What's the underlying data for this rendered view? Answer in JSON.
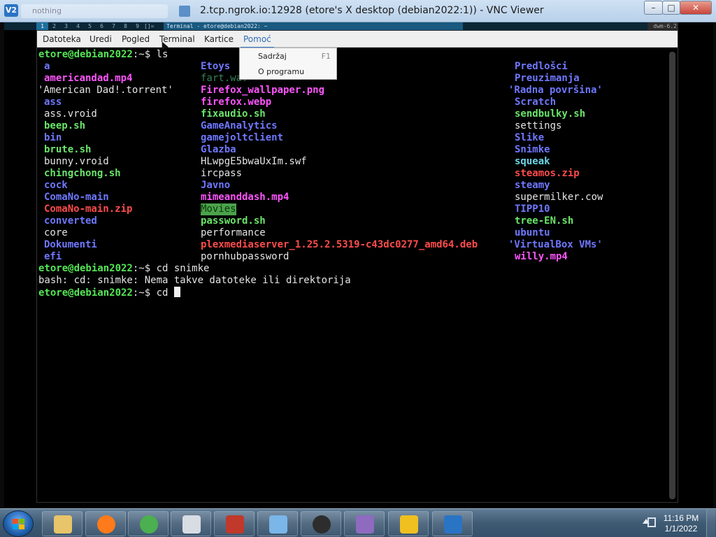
{
  "vnc_window": {
    "icon_label": "V2",
    "ghost_tab_label": "nothing",
    "title": "2.tcp.ngrok.io:12928 (etore's X desktop (debian2022:1)) - VNC Viewer",
    "buttons": {
      "minimize": "–",
      "maximize": "□",
      "close": "✕"
    }
  },
  "dwm": {
    "tags": [
      "1",
      "2",
      "3",
      "4",
      "5",
      "6",
      "7",
      "8",
      "9"
    ],
    "selected_tag": "1",
    "layout_symbol": "[]=",
    "window_title": "Terminal - etore@debian2022: ~",
    "status": "dwm-6.2"
  },
  "menubar": {
    "items": [
      "Datoteka",
      "Uredi",
      "Pogled",
      "Terminal",
      "Kartice",
      "Pomoć"
    ],
    "active": "Pomoć"
  },
  "help_menu": {
    "items": [
      {
        "label": "Sadržaj",
        "shortcut": "F1"
      },
      {
        "label": "O programu",
        "shortcut": ""
      }
    ]
  },
  "terminal": {
    "prompt": "etore@debian2022",
    "cwd": ":~$",
    "cmd1": "ls",
    "ls_col1": [
      {
        "name": "a",
        "type": "dir"
      },
      {
        "name": "americandad.mp4",
        "type": "media"
      },
      {
        "name": "'American Dad!.torrent'",
        "type": "plain"
      },
      {
        "name": "ass",
        "type": "dir"
      },
      {
        "name": "ass.vroid",
        "type": "plain"
      },
      {
        "name": "beep.sh",
        "type": "exec"
      },
      {
        "name": "bin",
        "type": "dir"
      },
      {
        "name": "brute.sh",
        "type": "exec"
      },
      {
        "name": "bunny.vroid",
        "type": "plain"
      },
      {
        "name": "chingchong.sh",
        "type": "exec"
      },
      {
        "name": "cock",
        "type": "dir"
      },
      {
        "name": "ComaNo-main",
        "type": "dir"
      },
      {
        "name": "ComaNo-main.zip",
        "type": "arch"
      },
      {
        "name": "converted",
        "type": "dir"
      },
      {
        "name": "core",
        "type": "plain"
      },
      {
        "name": "Dokumenti",
        "type": "dir"
      },
      {
        "name": "efi",
        "type": "dir"
      }
    ],
    "ls_col2": [
      {
        "name": "Etoys",
        "type": "dir"
      },
      {
        "name": "fart.wav",
        "type": "faint"
      },
      {
        "name": "Firefox_wallpaper.png",
        "type": "media"
      },
      {
        "name": "firefox.webp",
        "type": "media"
      },
      {
        "name": "fixaudio.sh",
        "type": "exec"
      },
      {
        "name": "GameAnalytics",
        "type": "dir"
      },
      {
        "name": "gamejoltclient",
        "type": "dir"
      },
      {
        "name": "Glazba",
        "type": "dir"
      },
      {
        "name": "HLwpgE5bwaUxIm.swf",
        "type": "plain"
      },
      {
        "name": "ircpass",
        "type": "plain"
      },
      {
        "name": "Javno",
        "type": "dir"
      },
      {
        "name": "mimeanddash.mp4",
        "type": "media"
      },
      {
        "name": "Movies",
        "type": "hilite"
      },
      {
        "name": "password.sh",
        "type": "exec"
      },
      {
        "name": "performance",
        "type": "plain"
      },
      {
        "name": "plexmediaserver_1.25.2.5319-c43dc0277_amd64.deb",
        "type": "arch"
      },
      {
        "name": "pornhubpassword",
        "type": "plain"
      }
    ],
    "ls_col3": [
      {
        "name": "Predlošci",
        "type": "dir"
      },
      {
        "name": "Preuzimanja",
        "type": "dir"
      },
      {
        "name": "'Radna površina'",
        "type": "dir"
      },
      {
        "name": "Scratch",
        "type": "dir"
      },
      {
        "name": "sendbulky.sh",
        "type": "exec"
      },
      {
        "name": "settings",
        "type": "plain"
      },
      {
        "name": "Slike",
        "type": "dir"
      },
      {
        "name": "Snimke",
        "type": "dir"
      },
      {
        "name": "squeak",
        "type": "cyan"
      },
      {
        "name": "steamos.zip",
        "type": "arch"
      },
      {
        "name": "steamy",
        "type": "dir"
      },
      {
        "name": "supermilker.cow",
        "type": "plain"
      },
      {
        "name": "TIPP10",
        "type": "dir"
      },
      {
        "name": "tree-EN.sh",
        "type": "exec"
      },
      {
        "name": "ubuntu",
        "type": "dir"
      },
      {
        "name": "'VirtualBox VMs'",
        "type": "dir"
      },
      {
        "name": "willy.mp4",
        "type": "media"
      }
    ],
    "cmd2": "cd snimke",
    "error": "bash: cd: snimke: Nema takve datoteke ili direktorija",
    "cmd3": "cd "
  },
  "taskbar": {
    "icons": [
      "explorer-icon",
      "firefox-icon",
      "chrome-icon",
      "calculator-icon",
      "toolbox-icon",
      "control-panel-icon",
      "media-center-icon",
      "archive-icon",
      "winamp-icon",
      "vnc-viewer-icon"
    ],
    "clock_time": "11:16 PM",
    "clock_date": "1/1/2022"
  }
}
